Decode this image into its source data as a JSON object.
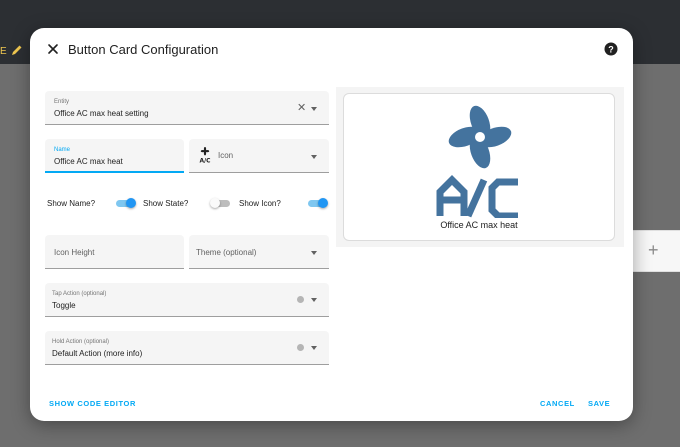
{
  "background": {
    "edge_label": "E"
  },
  "dialog": {
    "title": "Button Card Configuration",
    "entity": {
      "label": "Entity",
      "value": "Office AC max heat setting"
    },
    "name": {
      "label": "Name",
      "value": "Office AC max heat"
    },
    "icon": {
      "label": "Icon"
    },
    "toggles": [
      {
        "label": "Show Name?",
        "on": true
      },
      {
        "label": "Show State?",
        "on": false
      },
      {
        "label": "Show Icon?",
        "on": true
      }
    ],
    "icon_height": {
      "placeholder": "Icon Height"
    },
    "theme": {
      "placeholder": "Theme (optional)"
    },
    "tap_action": {
      "label": "Tap Action (optional)",
      "value": "Toggle"
    },
    "hold_action": {
      "label": "Hold Action (optional)",
      "value": "Default Action (more info)"
    },
    "preview": {
      "name": "Office AC max heat"
    },
    "footer": {
      "show_code_editor": "SHOW CODE EDITOR",
      "cancel": "CANCEL",
      "save": "SAVE"
    }
  },
  "colors": {
    "accent": "#03a9f4",
    "toggle_on": "#2196f3",
    "icon_color": "#44739e",
    "header": "#2c2f33"
  }
}
